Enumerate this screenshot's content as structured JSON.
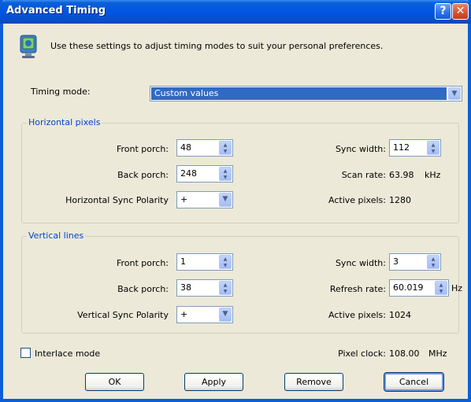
{
  "window": {
    "title": "Advanced Timing",
    "help_glyph": "?",
    "close_glyph": "✕"
  },
  "intro_text": "Use these settings to adjust timing modes to suit your personal preferences.",
  "timing_mode": {
    "label": "Timing mode:",
    "value": "Custom values"
  },
  "horizontal": {
    "title": "Horizontal pixels",
    "front_porch": {
      "label": "Front porch:",
      "value": "48"
    },
    "back_porch": {
      "label": "Back porch:",
      "value": "248"
    },
    "sync_polarity": {
      "label": "Horizontal Sync Polarity",
      "value": "+"
    },
    "sync_width": {
      "label": "Sync width:",
      "value": "112"
    },
    "scan_rate": {
      "label": "Scan rate:",
      "value": "63.98",
      "unit": "kHz"
    },
    "active_pixels": {
      "label": "Active pixels:",
      "value": "1280"
    }
  },
  "vertical": {
    "title": "Vertical lines",
    "front_porch": {
      "label": "Front porch:",
      "value": "1"
    },
    "back_porch": {
      "label": "Back porch:",
      "value": "38"
    },
    "sync_polarity": {
      "label": "Vertical Sync Polarity",
      "value": "+"
    },
    "sync_width": {
      "label": "Sync width:",
      "value": "3"
    },
    "refresh_rate": {
      "label": "Refresh rate:",
      "value": "60.019",
      "unit": "Hz"
    },
    "active_pixels": {
      "label": "Active pixels:",
      "value": "1024"
    }
  },
  "interlace": {
    "label": "Interlace mode",
    "checked": false
  },
  "pixel_clock": {
    "label": "Pixel clock:",
    "value": "108.00",
    "unit": "MHz"
  },
  "buttons": {
    "ok": "OK",
    "apply": "Apply",
    "remove": "Remove",
    "cancel": "Cancel"
  },
  "icons": {
    "intro": "monitor-info-icon",
    "dropdown": "chevron-down-icon",
    "spin_up": "spin-up-icon",
    "spin_down": "spin-down-icon"
  },
  "colors": {
    "titlebar": "#0054e3",
    "group_title": "#0046d5",
    "selection": "#316ac5",
    "dialog_bg": "#ece9d8"
  }
}
